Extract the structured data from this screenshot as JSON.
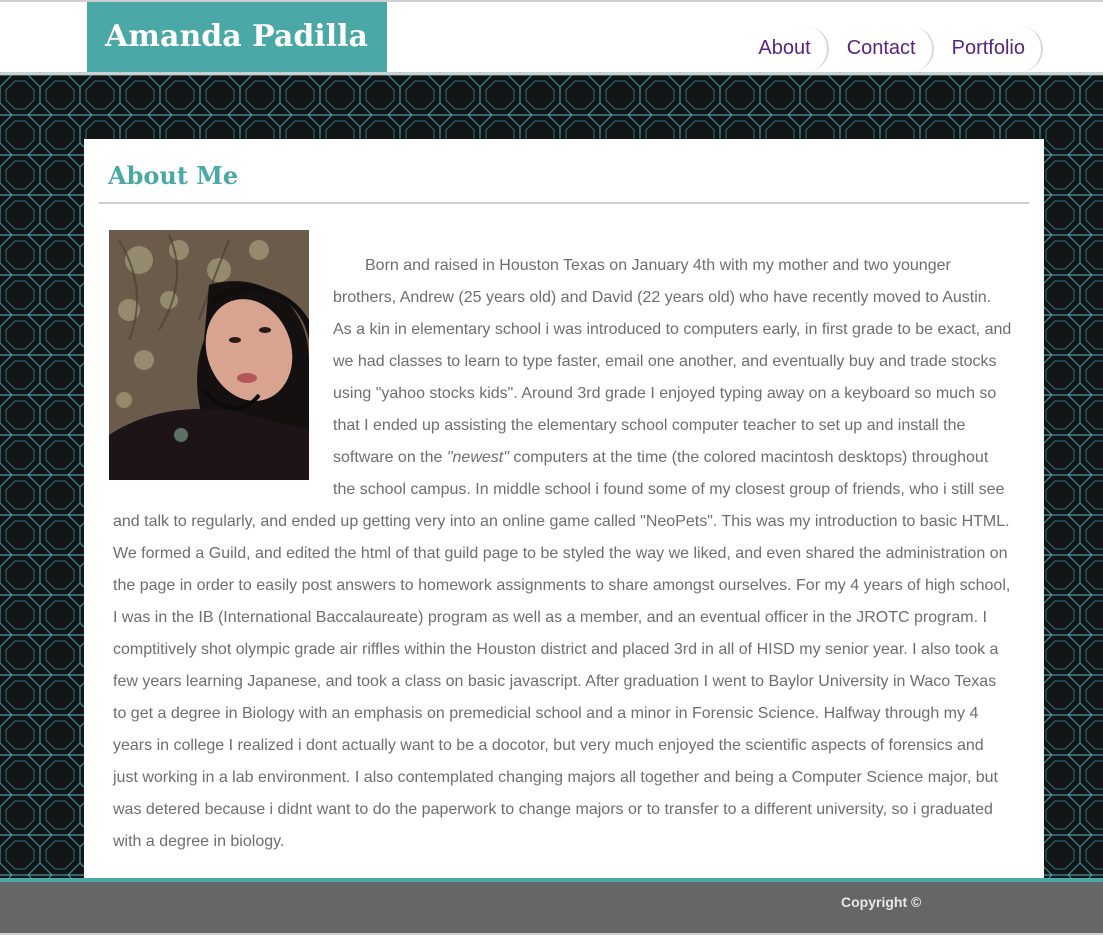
{
  "site": {
    "name": "Amanda Padilla"
  },
  "nav": {
    "items": [
      {
        "label": "About"
      },
      {
        "label": "Contact"
      },
      {
        "label": "Portfolio"
      }
    ]
  },
  "about": {
    "heading": "About Me",
    "photo_alt": "Portrait of Amanda Padilla",
    "bio_part1": "Born and raised in Houston Texas on January 4th with my mother and two younger brothers, Andrew (25 years old) and David (22 years old) who have recently moved to Austin. As a kin in elementary school i was introduced to computers early, in first grade to be exact, and we had classes to learn to type faster, email one another, and eventually buy and trade stocks using \"yahoo stocks kids\". Around 3rd grade I enjoyed typing away on a keyboard so much so that I ended up assisting the elementary school computer teacher to set up and install the software on the ",
    "bio_emphasis": "\"newest\"",
    "bio_part2": " computers at the time (the colored macintosh desktops) throughout the school campus. In middle school i found some of my closest group of friends, who i still see and talk to regularly, and ended up getting very into an online game called \"NeoPets\". This was my introduction to basic HTML. We formed a Guild, and edited the html of that guild page to be styled the way we liked, and even shared the administration on the page in order to easily post answers to homework assignments to share amongst ourselves. For my 4 years of high school, I was in the IB (International Baccalaureate) program as well as a member, and an eventual officer in the JROTC program. I comptitively shot olympic grade air riffles within the Houston district and placed 3rd in all of HISD my senior year. I also took a few years learning Japanese, and took a class on basic javascript. After graduation I went to Baylor University in Waco Texas to get a degree in Biology with an emphasis on premedicial school and a minor in Forensic Science. Halfway through my 4 years in college I realized i dont actually want to be a docotor, but very much enjoyed the scientific aspects of forensics and just working in a lab environment. I also contemplated changing majors all together and being a Computer Science major, but was detered because i didnt want to do the paperwork to change majors or to transfer to a different university, so i graduated with a degree in biology."
  },
  "footer": {
    "copyright": "Copyright ©"
  },
  "colors": {
    "brand_teal": "#4aa8a6",
    "nav_purple": "#5a2382",
    "body_text": "#6e6e6e",
    "footer_gray": "#666666",
    "pattern_dark": "#121516"
  }
}
